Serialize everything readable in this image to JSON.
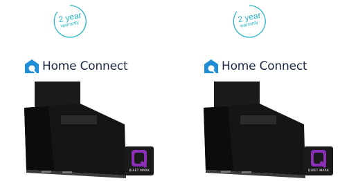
{
  "panels": [
    {
      "warranty": {
        "line1": "2 year",
        "line2": "warranty"
      },
      "brand": {
        "name": "Home Connect"
      },
      "badge": {
        "text": "QUIET MARK"
      }
    },
    {
      "warranty": {
        "line1": "2 year",
        "line2": "warranty"
      },
      "brand": {
        "name": "Home Connect"
      },
      "badge": {
        "text": "QUIET MARK"
      }
    }
  ],
  "colors": {
    "warranty_teal": "#27b5c6",
    "home_connect_blue": "#1f8ed6",
    "quiet_mark_purple": "#8b2fb8",
    "hood_black": "#141414"
  }
}
